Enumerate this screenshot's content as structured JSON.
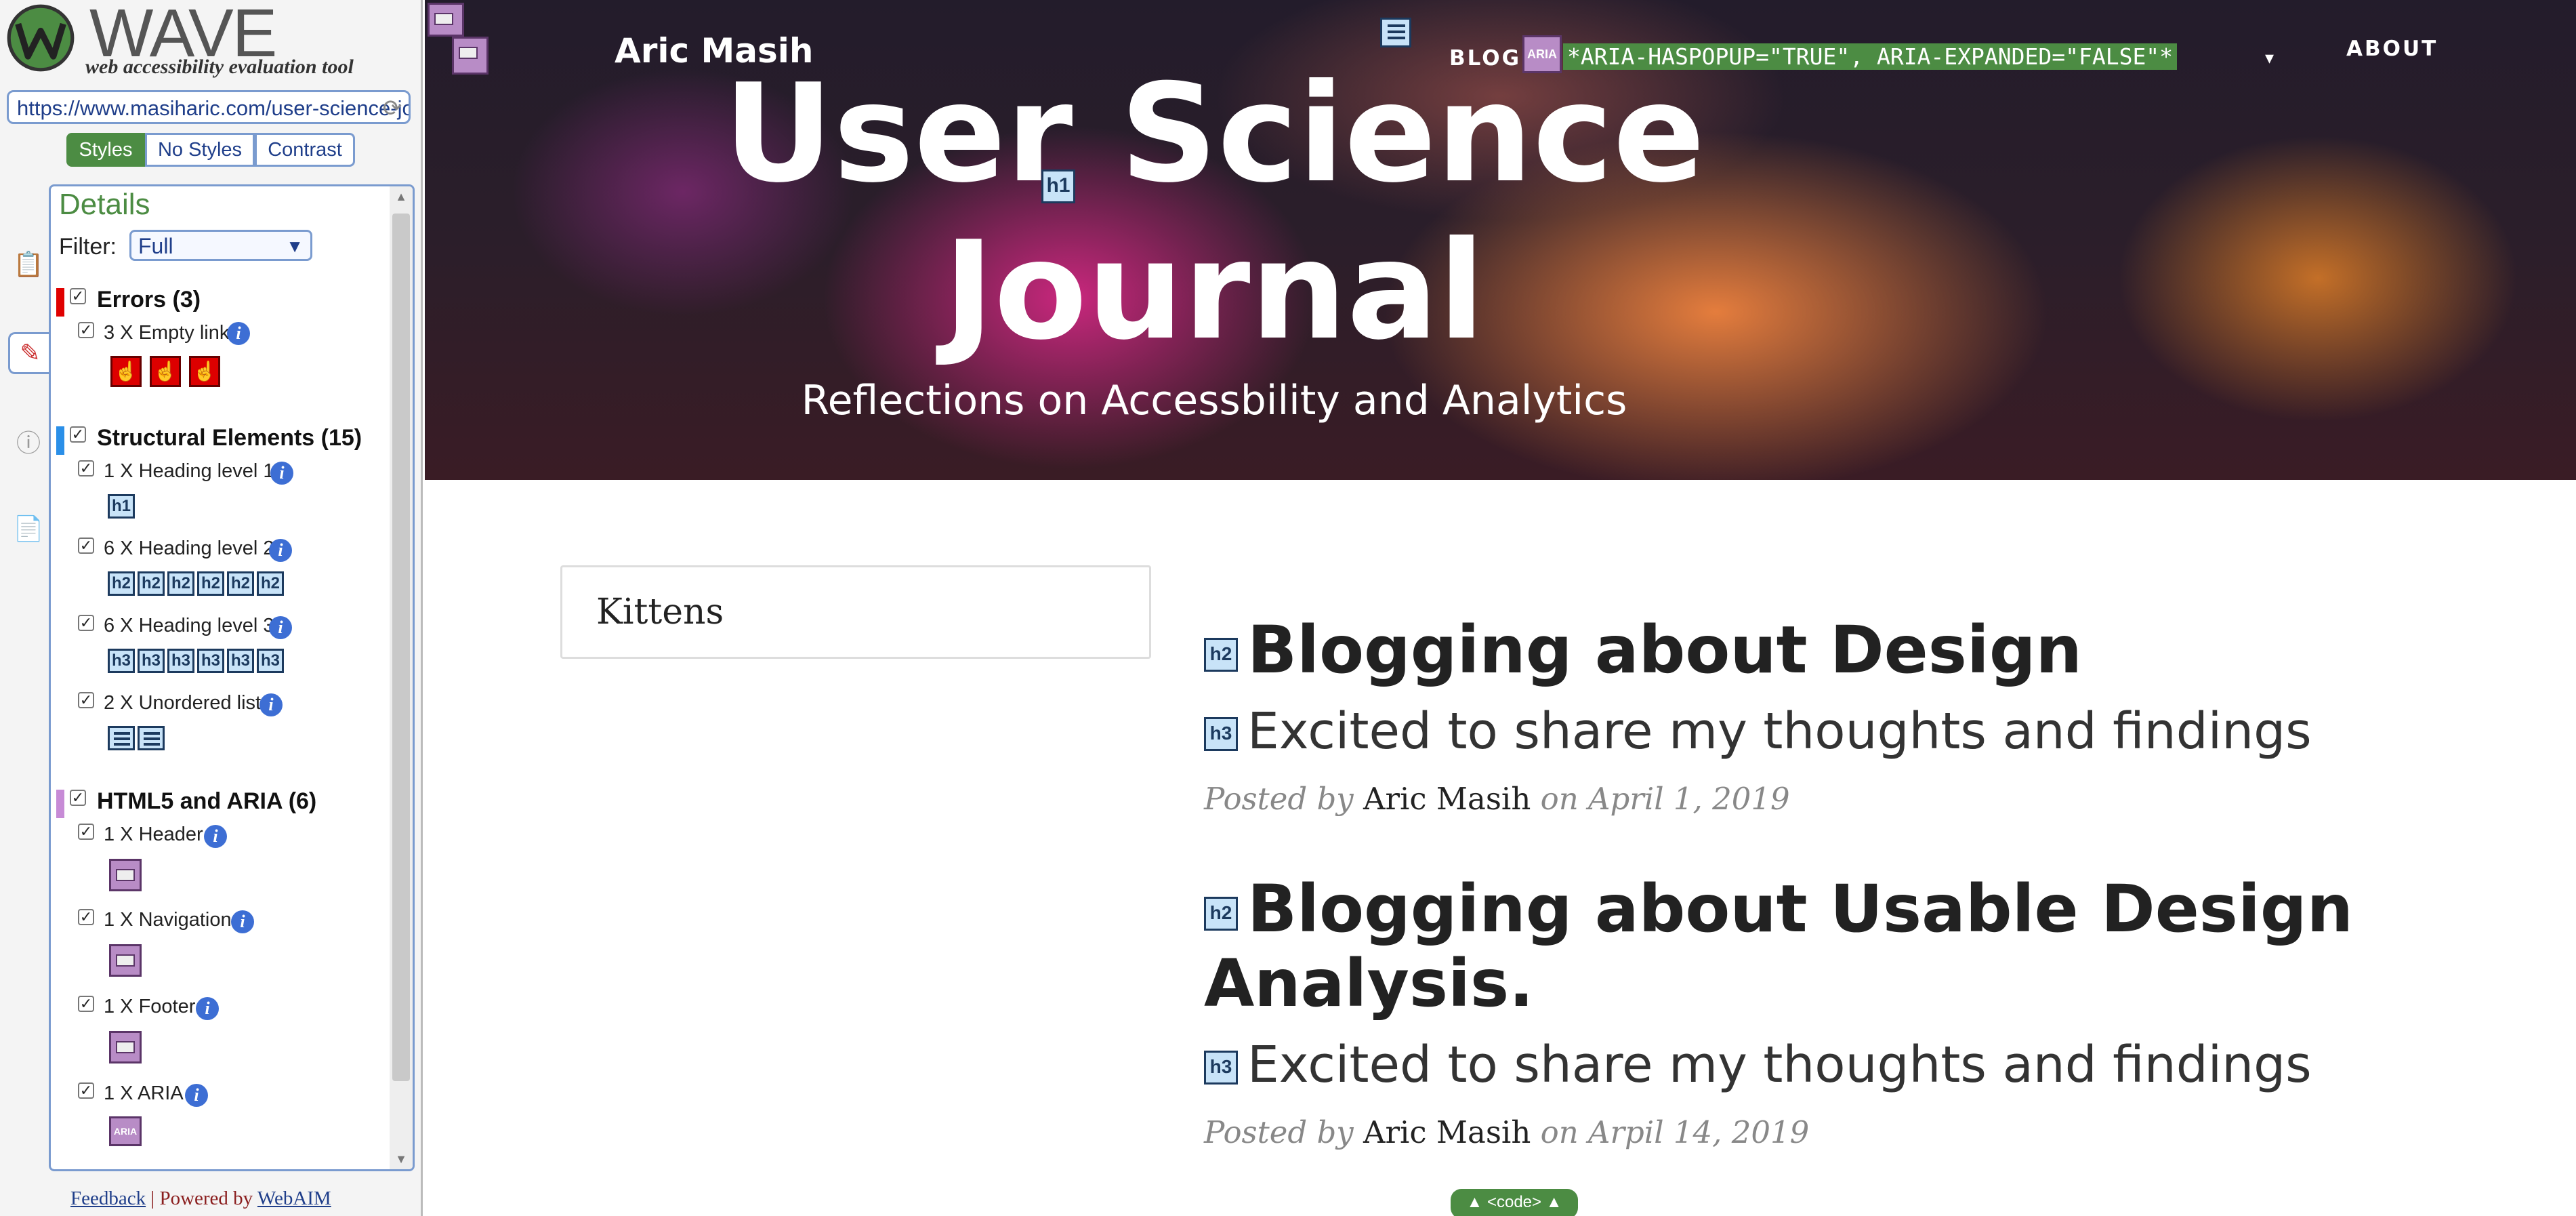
{
  "wave": {
    "title": "WAVE",
    "subtitle": "web accessibility evaluation tool",
    "url": "https://www.masiharic.com/user-science-journal/",
    "views": [
      "Styles",
      "No Styles",
      "Contrast"
    ],
    "details_title": "Details",
    "filter_label": "Filter:",
    "filter_value": "Full",
    "categories": {
      "errors": {
        "title": "Errors (3)",
        "color": "#e00000",
        "items": [
          {
            "label": "3 X Empty link"
          }
        ]
      },
      "structural": {
        "title": "Structural Elements (15)",
        "color": "#2a8fe8",
        "items": [
          {
            "label": "1 X Heading level 1",
            "badge": "h1"
          },
          {
            "label": "6 X Heading level 2",
            "badge": "h2"
          },
          {
            "label": "6 X Heading level 3",
            "badge": "h3"
          },
          {
            "label": "2 X Unordered list"
          }
        ]
      },
      "html5": {
        "title": "HTML5 and ARIA (6)",
        "color": "#c78bd6",
        "items": [
          {
            "label": "1 X Header"
          },
          {
            "label": "1 X Navigation"
          },
          {
            "label": "1 X Footer"
          },
          {
            "label": "1 X ARIA",
            "badge": "ARIA"
          }
        ]
      }
    },
    "footer": {
      "feedback": "Feedback",
      "separator": "|",
      "powered": "Powered by",
      "webaim": "WebAIM"
    }
  },
  "page": {
    "brand": "Aric Masih",
    "nav": {
      "blog": "BLOG",
      "about": "ABOUT",
      "aria_badge": "ARIA",
      "aria_note": "*ARIA-HASPOPUP=\"TRUE\", ARIA-EXPANDED=\"FALSE\"*"
    },
    "hero": {
      "title_line1": "User Science",
      "title_line2": "Journal",
      "subtitle": "Reflections on Accessbility and Analytics",
      "h1_badge": "h1"
    },
    "search_text": "Kittens",
    "posts": [
      {
        "h2_badge": "h2",
        "title": "Blogging about Design",
        "h3_badge": "h3",
        "subtitle": "Excited to share my thoughts and findings",
        "posted_by": "Posted by",
        "author": "Aric Masih",
        "date": "on April 1, 2019"
      },
      {
        "h2_badge": "h2",
        "title": "Blogging about Usable Design Analysis.",
        "h3_badge": "h3",
        "subtitle": "Excited to share my thoughts and findings",
        "posted_by": "Posted by",
        "author": "Aric Masih",
        "date": "on Arpil 14, 2019"
      }
    ],
    "code_badge": "▲ <code> ▲"
  }
}
